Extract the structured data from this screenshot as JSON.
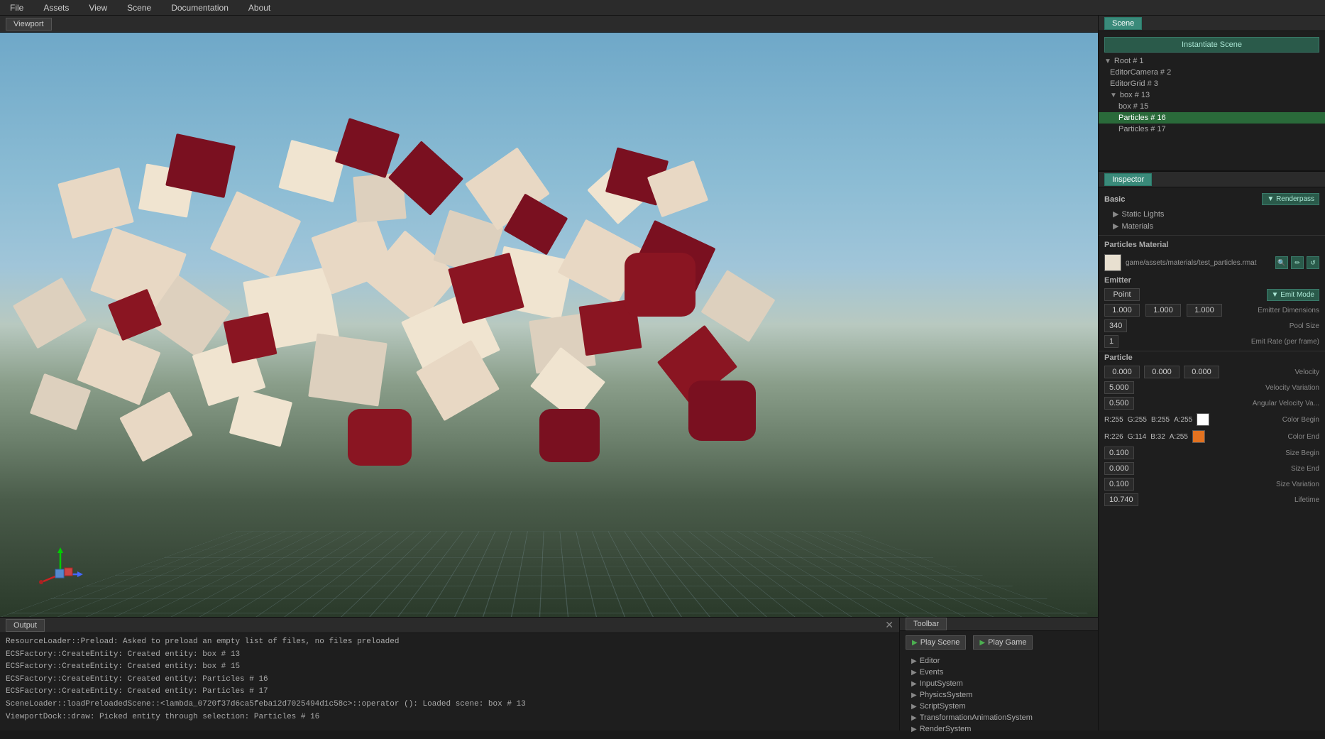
{
  "menubar": {
    "items": [
      "File",
      "Assets",
      "View",
      "Scene",
      "Documentation",
      "About"
    ]
  },
  "viewport": {
    "tab_label": "Viewport"
  },
  "scene_panel": {
    "tab_label": "Scene",
    "instantiate_btn": "Instantiate Scene",
    "tree": [
      {
        "label": "Root # 1",
        "level": 1,
        "has_arrow": true,
        "arrow": "▼",
        "selected": false
      },
      {
        "label": "EditorCamera # 2",
        "level": 2,
        "has_arrow": false,
        "selected": false
      },
      {
        "label": "EditorGrid # 3",
        "level": 2,
        "has_arrow": false,
        "selected": false
      },
      {
        "label": "box # 13",
        "level": 2,
        "has_arrow": true,
        "arrow": "▼",
        "selected": false
      },
      {
        "label": "box # 15",
        "level": 3,
        "has_arrow": false,
        "selected": false
      },
      {
        "label": "Particles # 16",
        "level": 3,
        "has_arrow": false,
        "selected": true
      },
      {
        "label": "Particles # 17",
        "level": 3,
        "has_arrow": false,
        "selected": false
      }
    ]
  },
  "inspector": {
    "tab_label": "Inspector",
    "basic_label": "Basic",
    "renderpass_btn": "Renderpass",
    "sub_items": [
      "Static Lights",
      "Materials"
    ],
    "particles_material_label": "Particles Material",
    "material_path": "game/assets/materials/test_particles.rmat",
    "material_icons": [
      "🔍",
      "✏",
      "↺"
    ],
    "emitter_label": "Emitter",
    "emitter_type": "Point",
    "emit_mode_btn": "Emit Mode",
    "emitter_dims": [
      "1.000",
      "1.000",
      "1.000"
    ],
    "emitter_dims_label": "Emitter Dimensions",
    "pool_size_val": "340",
    "pool_size_label": "Pool Size",
    "emit_rate_val": "1",
    "emit_rate_label": "Emit Rate (per frame)",
    "particle_label": "Particle",
    "velocity_vals": [
      "0.000",
      "0.000",
      "0.000"
    ],
    "velocity_label": "Velocity",
    "velocity_var_val": "5.000",
    "velocity_var_label": "Velocity Variation",
    "angular_vel_val": "0.500",
    "angular_vel_label": "Angular Velocity Va...",
    "color_begin_rgba": {
      "r": "R:255",
      "g": "G:255",
      "b": "B:255",
      "a": "A:255"
    },
    "color_begin_label": "Color Begin",
    "color_begin_hex": "#ffffff",
    "color_end_rgba": {
      "r": "R:226",
      "g": "G:114",
      "b": "B:32",
      "a": "A:255"
    },
    "color_end_label": "Color End",
    "color_end_hex": "#e27220",
    "size_begin_val": "0.100",
    "size_begin_label": "Size Begin",
    "size_end_val": "0.000",
    "size_end_label": "Size End",
    "size_var_val": "0.100",
    "size_var_label": "Size Variation",
    "lifetime_val": "10.740",
    "lifetime_label": "Lifetime"
  },
  "output": {
    "tab_label": "Output",
    "lines": [
      "ResourceLoader::Preload: Asked to preload an empty list of files, no files preloaded",
      "ECSFactory::CreateEntity: Created entity: box # 13",
      "ECSFactory::CreateEntity: Created entity: box # 15",
      "ECSFactory::CreateEntity: Created entity: Particles # 16",
      "ECSFactory::CreateEntity: Created entity: Particles # 17",
      "SceneLoader::loadPreloadedScene::<lambda_0720f37d6ca5feba12d7025494d1c58c>::operator (): Loaded scene: box # 13",
      "ViewportDock::draw: Picked entity through selection: Particles # 16"
    ]
  },
  "toolbar": {
    "tab_label": "Toolbar",
    "play_scene_btn": "Play Scene",
    "play_game_btn": "Play Game",
    "tree_items": [
      "Editor",
      "Events",
      "InputSystem",
      "PhysicsSystem",
      "ScriptSystem",
      "TransformationAnimationSystem",
      "RenderSystem"
    ]
  }
}
